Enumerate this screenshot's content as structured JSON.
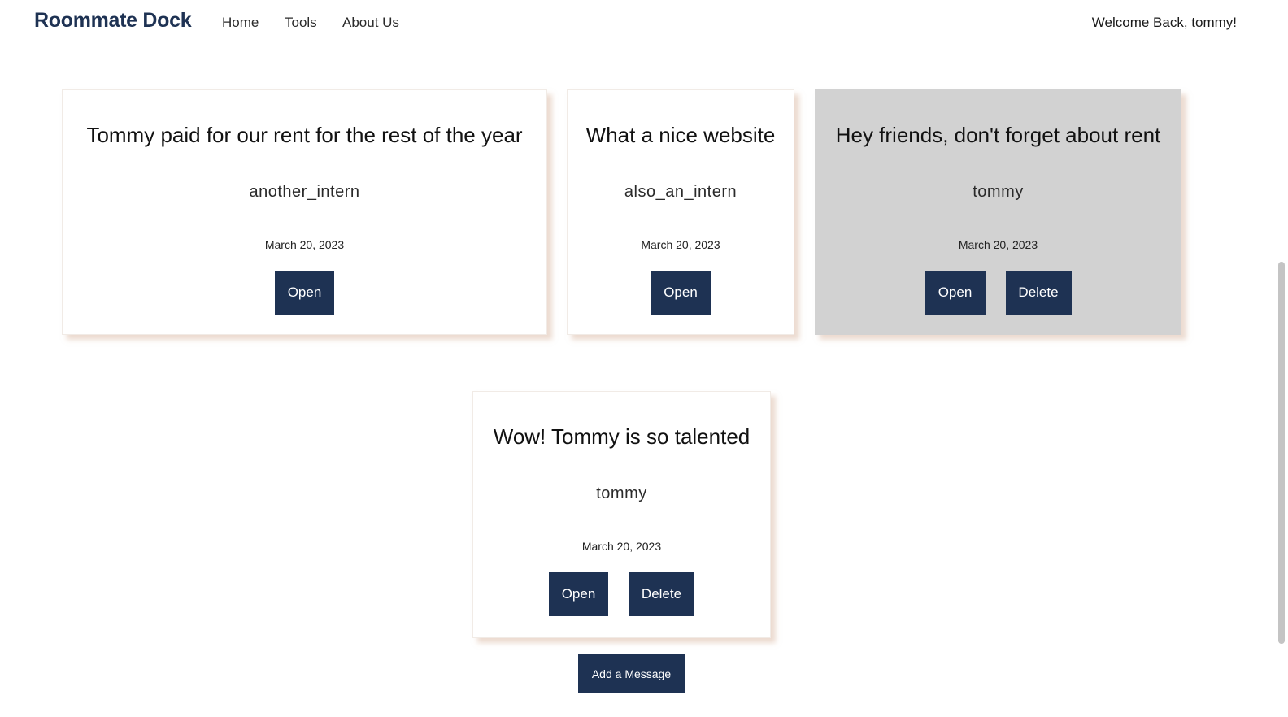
{
  "header": {
    "brand": "Roommate Dock",
    "nav": [
      {
        "label": "Home"
      },
      {
        "label": "Tools"
      },
      {
        "label": "About Us"
      }
    ],
    "welcome": "Welcome Back, tommy!"
  },
  "messages": [
    {
      "title": "Tommy paid for our rent for the rest of the year",
      "author": "another_intern",
      "date": "March 20, 2023",
      "open_label": "Open"
    },
    {
      "title": "What a nice website",
      "author": "also_an_intern",
      "date": "March 20, 2023",
      "open_label": "Open"
    },
    {
      "title": "Hey friends, don't forget about rent",
      "author": "tommy",
      "date": "March 20, 2023",
      "open_label": "Open",
      "delete_label": "Delete"
    },
    {
      "title": "Wow! Tommy is so talented",
      "author": "tommy",
      "date": "March 20, 2023",
      "open_label": "Open",
      "delete_label": "Delete"
    }
  ],
  "add_message_label": "Add a Message",
  "colors": {
    "accent": "#1e3253",
    "highlight_card": "#d2d2d2"
  }
}
